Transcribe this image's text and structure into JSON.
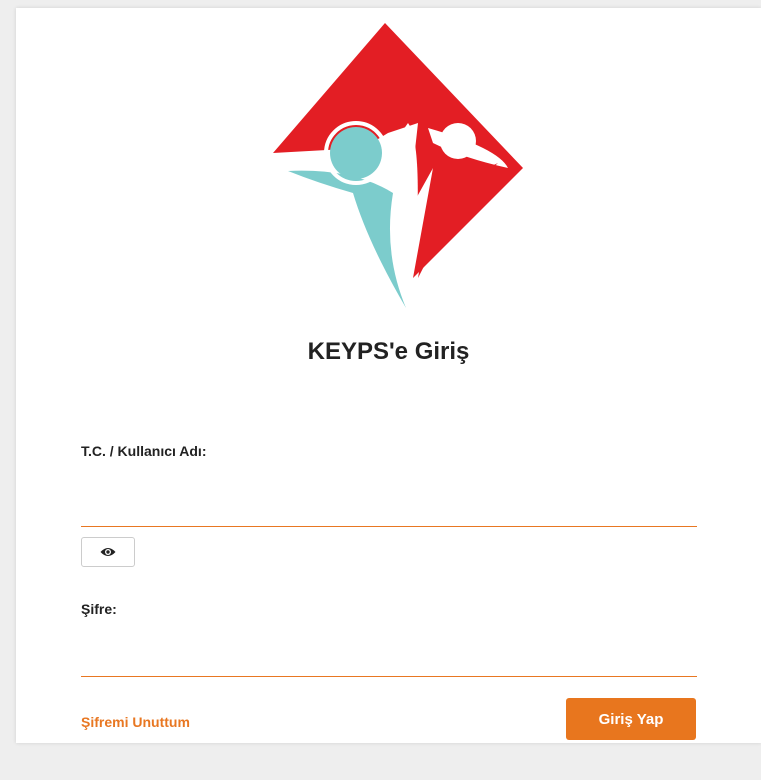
{
  "login": {
    "title": "KEYPS'e Giriş",
    "username_label": "T.C. / Kullanıcı Adı:",
    "username_value": "",
    "password_label": "Şifre:",
    "password_value": "",
    "forgot_password": "Şifremi Unuttum",
    "submit": "Giriş Yap"
  },
  "icons": {
    "logo": "keyps-logo",
    "toggle_visibility": "eye-icon"
  },
  "colors": {
    "accent": "#e87722",
    "logo_red": "#e31e24",
    "logo_teal": "#7ccccc"
  }
}
